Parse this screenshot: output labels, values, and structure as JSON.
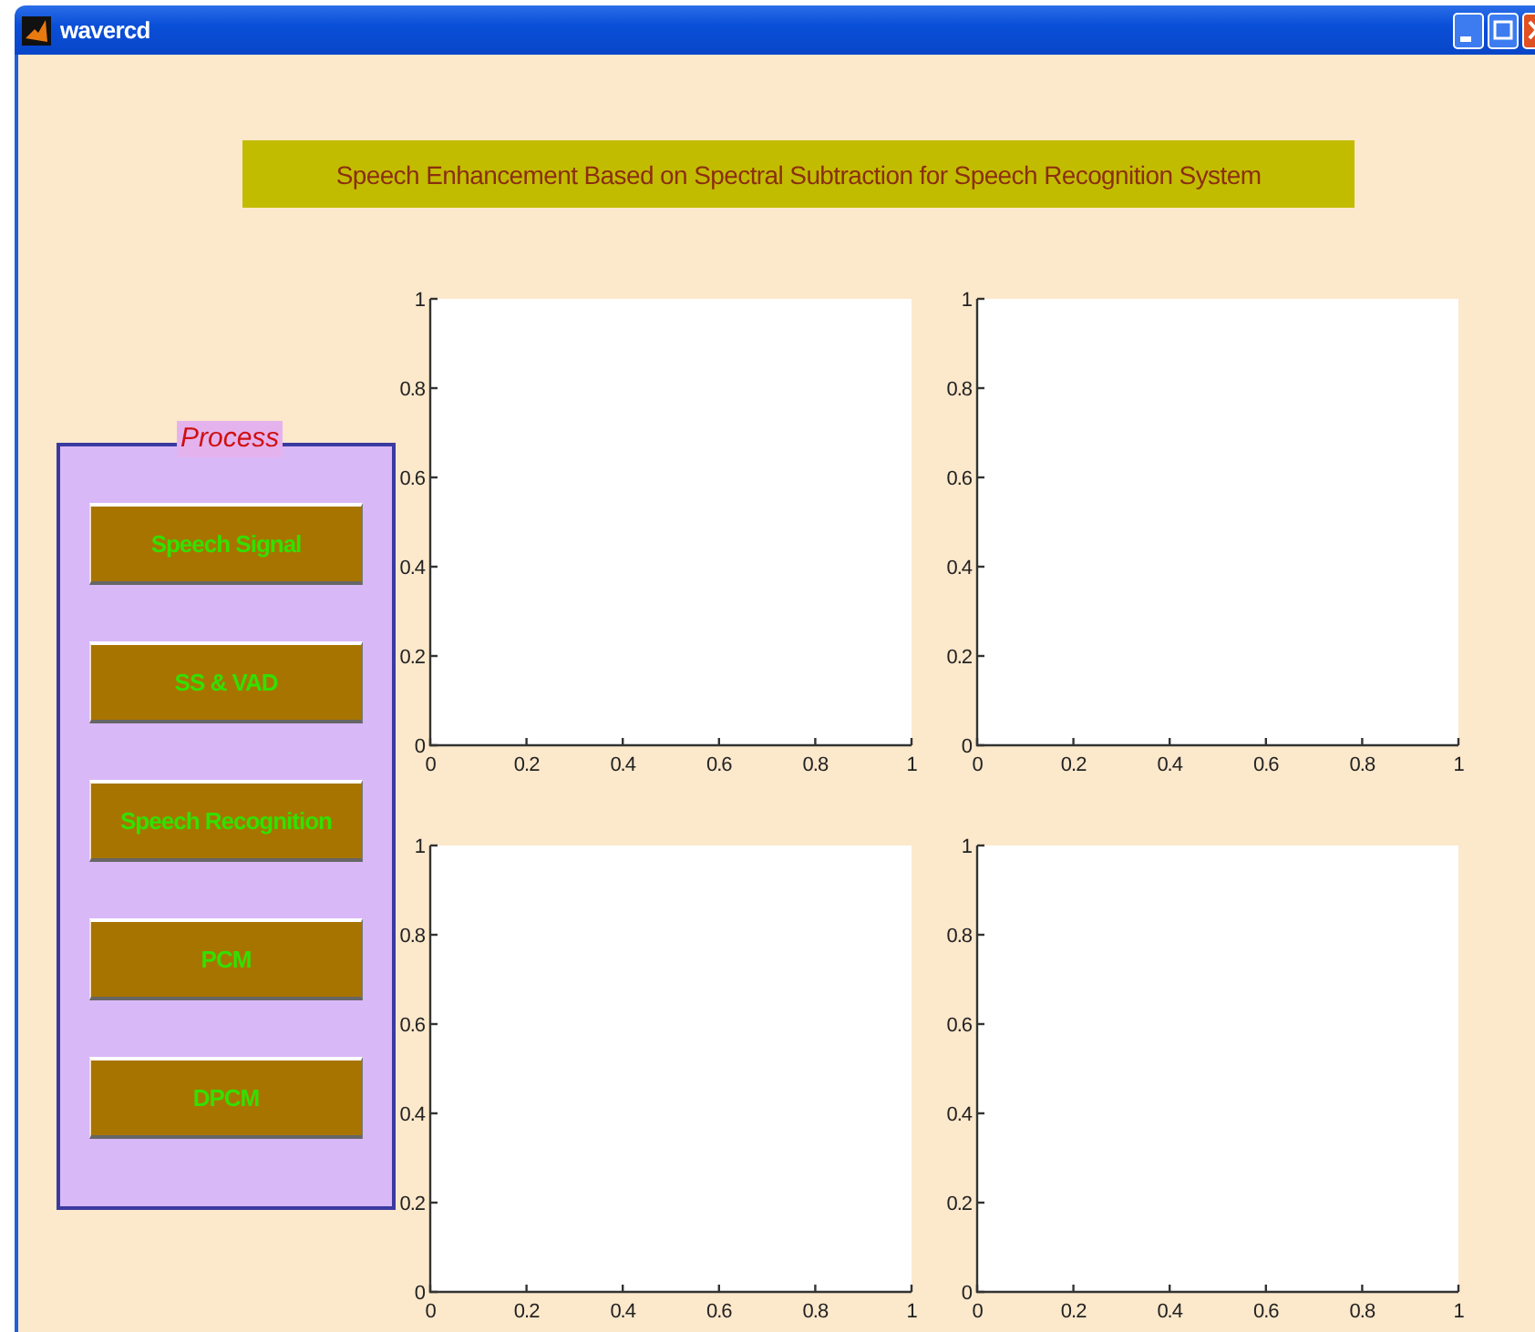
{
  "window": {
    "title": "wavercd"
  },
  "banner": "Speech Enhancement Based on Spectral Subtraction for Speech Recognition System",
  "panel": {
    "title": "Process",
    "buttons": [
      "Speech Signal",
      "SS & VAD",
      "Speech Recognition",
      "PCM",
      "DPCM"
    ]
  },
  "axes": [
    {
      "xticks": [
        "0",
        "0.2",
        "0.4",
        "0.6",
        "0.8",
        "1"
      ],
      "yticks": [
        "1",
        "0.8",
        "0.6",
        "0.4",
        "0.2",
        "0"
      ]
    },
    {
      "xticks": [
        "0",
        "0.2",
        "0.4",
        "0.6",
        "0.8",
        "1"
      ],
      "yticks": [
        "1",
        "0.8",
        "0.6",
        "0.4",
        "0.2",
        "0"
      ]
    },
    {
      "xticks": [
        "0",
        "0.2",
        "0.4",
        "0.6",
        "0.8",
        "1"
      ],
      "yticks": [
        "1",
        "0.8",
        "0.6",
        "0.4",
        "0.2",
        "0"
      ]
    },
    {
      "xticks": [
        "0",
        "0.2",
        "0.4",
        "0.6",
        "0.8",
        "1"
      ],
      "yticks": [
        "1",
        "0.8",
        "0.6",
        "0.4",
        "0.2",
        "0"
      ]
    }
  ]
}
